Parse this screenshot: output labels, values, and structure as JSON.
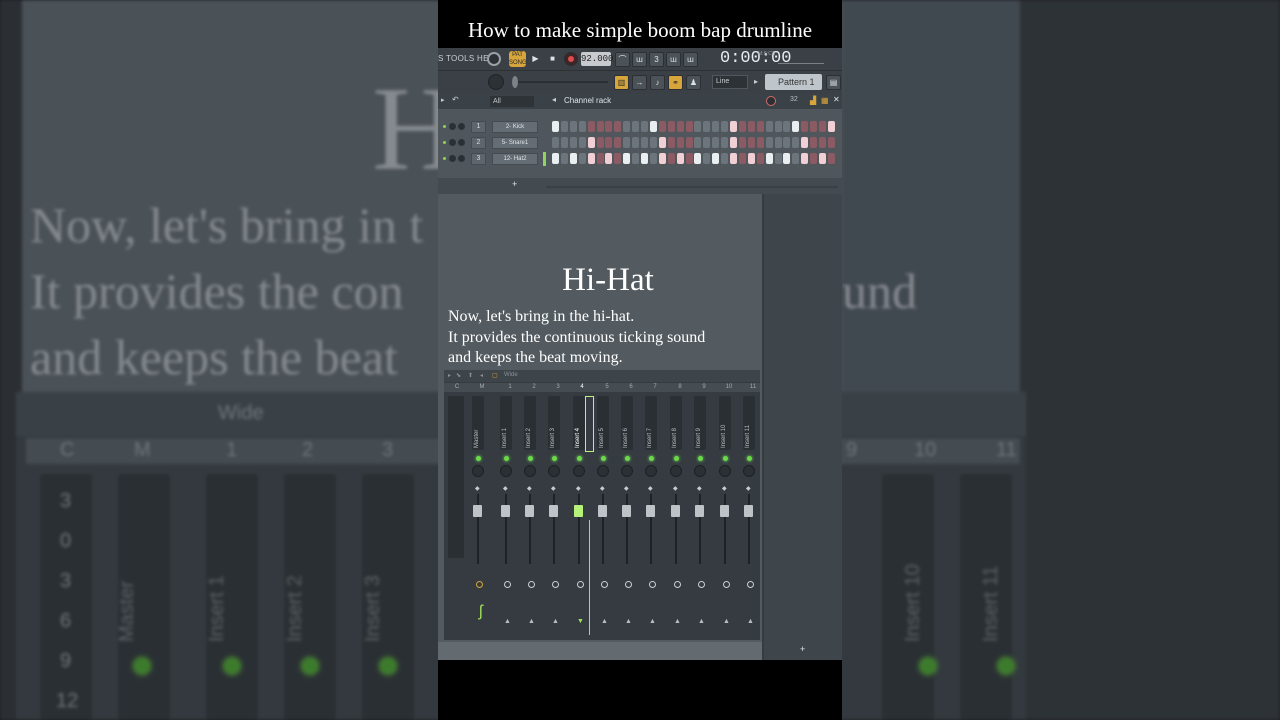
{
  "video_title": "How to make simple boom bap drumline",
  "background": {
    "big_letters": "Hi",
    "line1": "Now, let's bring in t",
    "line2_left": "It provides the con",
    "line2_right": "und",
    "line3": "and keeps the beat",
    "mixer_label": "Wide",
    "col_c": "C",
    "col_m": "M",
    "col_nums": [
      "1",
      "2",
      "3",
      "9",
      "10",
      "11"
    ],
    "scale": [
      "3",
      "0",
      "3",
      "6",
      "9",
      "12"
    ],
    "strips": [
      "Master",
      "Insert 1",
      "Insert 2",
      "Insert 3",
      "Insert 10",
      "Insert 11"
    ]
  },
  "toolbar": {
    "menu": "S TOOLS HELP",
    "pat_label": "PAT SONG",
    "tempo": "92.000",
    "time": "0:00:00",
    "time_caption": "M:S:CS",
    "snap": "Line",
    "pattern": "Pattern 1",
    "icons": [
      "pattern-song-toggle",
      "play",
      "stop",
      "record",
      "metronome",
      "wait",
      "countdown",
      "step-edit",
      "loop-record",
      "playlist",
      "piano-roll",
      "channel-rack",
      "mixer",
      "plugin-picker"
    ]
  },
  "channel_rack": {
    "filter": "All",
    "title": "Channel rack",
    "steps": "32",
    "channels": [
      {
        "num": "1",
        "name": "2- Kick",
        "pattern": [
          1,
          0,
          0,
          0,
          0,
          0,
          0,
          0,
          0,
          0,
          0,
          1,
          0,
          0,
          0,
          0,
          0,
          0,
          0,
          0,
          1,
          0,
          0,
          0,
          0,
          0,
          0,
          1,
          0,
          0,
          0,
          1
        ]
      },
      {
        "num": "2",
        "name": "5- Snare1",
        "pattern": [
          0,
          0,
          0,
          0,
          1,
          0,
          0,
          0,
          0,
          0,
          0,
          0,
          1,
          0,
          0,
          0,
          0,
          0,
          0,
          0,
          1,
          0,
          0,
          0,
          0,
          0,
          0,
          0,
          1,
          0,
          0,
          0
        ]
      },
      {
        "num": "3",
        "name": "12- Hat2",
        "pattern": [
          1,
          0,
          1,
          0,
          1,
          0,
          1,
          0,
          1,
          0,
          1,
          0,
          1,
          0,
          1,
          0,
          1,
          0,
          1,
          0,
          1,
          0,
          1,
          0,
          1,
          0,
          1,
          0,
          1,
          0,
          1,
          0
        ]
      }
    ],
    "add_label": "+"
  },
  "overlay": {
    "title": "Hi-Hat",
    "lines": [
      "Now, let's bring in the hi-hat.",
      "It provides the continuous ticking sound",
      "and keeps the beat moving."
    ]
  },
  "mixer": {
    "preset": "Wide",
    "header_c": "C",
    "header_m": "M",
    "header_nums": [
      "1",
      "2",
      "3",
      "4",
      "5",
      "6",
      "7",
      "8",
      "9",
      "10",
      "11"
    ],
    "strips": [
      "Master",
      "Insert 1",
      "Insert 2",
      "Insert 3",
      "Insert 4",
      "Insert 5",
      "Insert 6",
      "Insert 7",
      "Insert 8",
      "Insert 9",
      "Insert 10",
      "Insert 11"
    ],
    "selected": "Insert 4",
    "add_label": "+"
  },
  "colors": {
    "accent_green": "#6ad94a",
    "pattern_orange": "#d7a53a",
    "record_red": "#e04a4a"
  }
}
